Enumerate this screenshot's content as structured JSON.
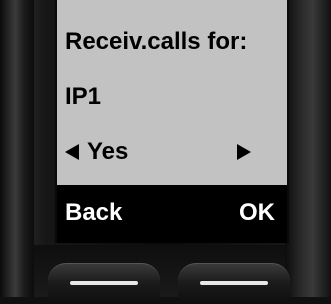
{
  "screen": {
    "title": "Receiv.calls for:",
    "account": "IP1",
    "option": {
      "value": "Yes",
      "left_arrow_icon": "triangle-left-icon",
      "right_arrow_icon": "triangle-right-icon"
    }
  },
  "softkeys": {
    "left_label": "Back",
    "right_label": "OK"
  },
  "colors": {
    "display_background": "#c2c2c2",
    "softkey_bar": "#000000",
    "softkey_text": "#ffffff",
    "display_text": "#000000"
  }
}
